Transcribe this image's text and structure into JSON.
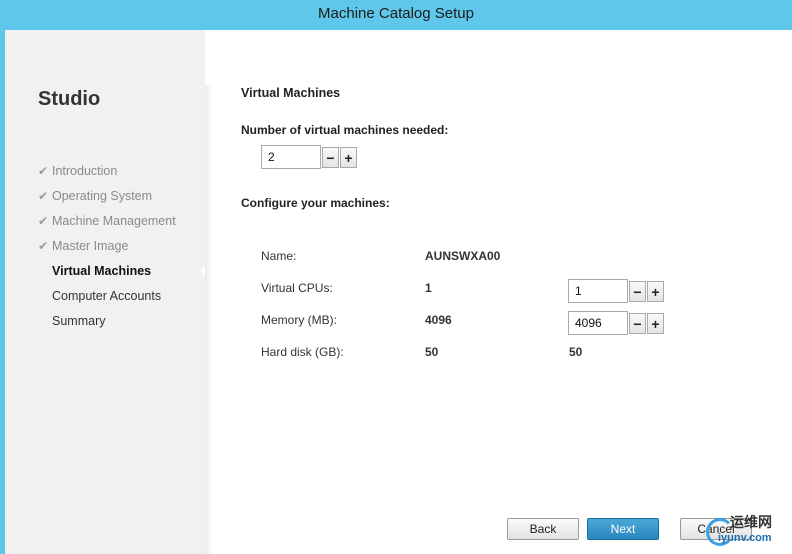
{
  "window": {
    "title": "Machine Catalog Setup"
  },
  "sidebar": {
    "product": "Studio",
    "steps": [
      {
        "label": "Introduction",
        "state": "done"
      },
      {
        "label": "Operating System",
        "state": "done"
      },
      {
        "label": "Machine Management",
        "state": "done"
      },
      {
        "label": "Master Image",
        "state": "done"
      },
      {
        "label": "Virtual Machines",
        "state": "active"
      },
      {
        "label": "Computer Accounts",
        "state": "pending"
      },
      {
        "label": "Summary",
        "state": "pending"
      }
    ],
    "check_glyph": "✔"
  },
  "main": {
    "section_title": "Virtual Machines",
    "num_vms_label": "Number of virtual machines needed:",
    "num_vms_value": "2",
    "configure_label": "Configure your machines:",
    "rows": [
      {
        "label": "Name:",
        "value": "AUNSWXA00"
      },
      {
        "label": "Virtual CPUs:",
        "value": "1",
        "input": "1"
      },
      {
        "label": "Memory (MB):",
        "value": "4096",
        "input": "4096"
      },
      {
        "label": "Hard disk (GB):",
        "value": "50",
        "value2": "50"
      }
    ],
    "minus": "−",
    "plus": "+"
  },
  "footer": {
    "back": "Back",
    "next": "Next",
    "cancel": "Cancel"
  },
  "watermark": {
    "top": "运维网",
    "bottom": "iyunv.com"
  }
}
